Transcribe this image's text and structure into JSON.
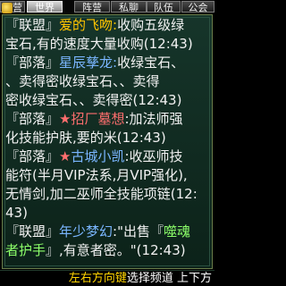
{
  "tabs": [
    {
      "label": "世界",
      "active": true
    },
    {
      "label": "阵营",
      "active": false
    },
    {
      "label": "私聊",
      "active": false
    },
    {
      "label": "队伍",
      "active": false
    },
    {
      "label": "公会",
      "active": false
    }
  ],
  "left_tab_partial": "营",
  "messages": [
    {
      "lines": [
        [
          {
            "t": "『联盟』",
            "c": "bracket"
          },
          {
            "t": "爱的飞吻:",
            "c": "name-gold"
          },
          {
            "t": "收购五级绿",
            "c": "txt"
          }
        ],
        [
          {
            "t": "宝石,有的速度大量收购(12:43)",
            "c": "txt"
          }
        ]
      ]
    },
    {
      "lines": [
        [
          {
            "t": "『部落』",
            "c": "bracket"
          },
          {
            "t": "星辰孳龙:",
            "c": "name-blue"
          },
          {
            "t": "收绿宝石、",
            "c": "txt"
          }
        ],
        [
          {
            "t": "、卖得密收绿宝石、、卖得",
            "c": "txt"
          }
        ],
        [
          {
            "t": "密收绿宝石、、卖得密(12:43)",
            "c": "txt"
          }
        ]
      ]
    },
    {
      "lines": [
        [
          {
            "t": "『部落』",
            "c": "bracket"
          },
          {
            "t": "★",
            "c": "star"
          },
          {
            "t": "招厂墓想",
            "c": "name-red"
          },
          {
            "t": ":加法师强",
            "c": "txt"
          }
        ],
        [
          {
            "t": "化技能护肤,要的米(12:43)",
            "c": "txt"
          }
        ]
      ]
    },
    {
      "lines": [
        [
          {
            "t": "『部落』",
            "c": "bracket"
          },
          {
            "t": "★",
            "c": "star"
          },
          {
            "t": "古城小凯",
            "c": "name-blue"
          },
          {
            "t": ":收巫师技",
            "c": "txt"
          }
        ],
        [
          {
            "t": "能符(半月VIP法系,月VIP强化),",
            "c": "txt"
          }
        ],
        [
          {
            "t": "无情剑,加二巫师全技能项链(12:",
            "c": "txt"
          }
        ],
        [
          {
            "t": "43)",
            "c": "txt"
          }
        ]
      ]
    },
    {
      "lines": [
        [
          {
            "t": "『联盟』",
            "c": "bracket"
          },
          {
            "t": "年少梦幻",
            "c": "name-blue"
          },
          {
            "t": ":\"出售『",
            "c": "txt"
          },
          {
            "t": "噬魂",
            "c": "name-green"
          }
        ],
        [
          {
            "t": "者护手",
            "c": "name-green"
          },
          {
            "t": "』,有意者密。\"(12:43)",
            "c": "txt"
          }
        ]
      ]
    }
  ],
  "footer": {
    "key_text": "左右方向键",
    "rest_text": "选择频道 上下方"
  },
  "colors": {
    "panel_bg": "#16352a",
    "gold": "#ffc400",
    "blue": "#7ab6ff",
    "red": "#ff6e6e",
    "green": "#8cff6a",
    "hint_key": "#ffd400"
  }
}
